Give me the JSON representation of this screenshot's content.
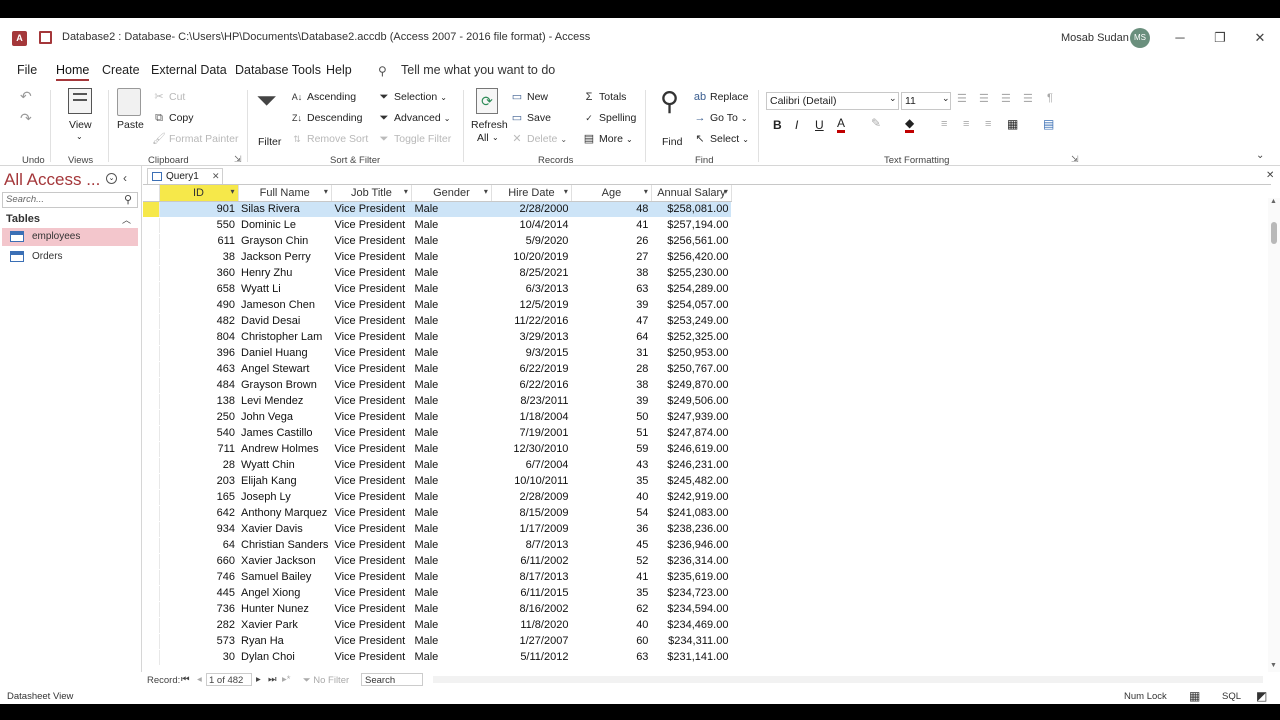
{
  "window": {
    "title": "Database2 : Database- C:\\Users\\HP\\Documents\\Database2.accdb (Access 2007 - 2016 file format)  -  Access",
    "user": "Mosab Sudan",
    "user_initials": "MS"
  },
  "menu": {
    "items": [
      "File",
      "Home",
      "Create",
      "External Data",
      "Database Tools",
      "Help"
    ],
    "tell_me": "Tell me what you want to do"
  },
  "ribbon": {
    "undo_label": "Undo",
    "views_label": "Views",
    "view_btn": "View",
    "clipboard": {
      "paste": "Paste",
      "cut": "Cut",
      "copy": "Copy",
      "format_painter": "Format Painter",
      "label": "Clipboard"
    },
    "sort": {
      "filter": "Filter",
      "ascending": "Ascending",
      "descending": "Descending",
      "remove_sort": "Remove Sort",
      "selection": "Selection",
      "advanced": "Advanced",
      "toggle_filter": "Toggle Filter",
      "label": "Sort & Filter"
    },
    "records": {
      "refresh": "Refresh",
      "all": "All",
      "new": "New",
      "save": "Save",
      "delete": "Delete",
      "totals": "Totals",
      "spelling": "Spelling",
      "more": "More",
      "label": "Records"
    },
    "find": {
      "find": "Find",
      "replace": "Replace",
      "goto": "Go To",
      "select": "Select",
      "label": "Find"
    },
    "text": {
      "font": "Calibri (Detail)",
      "size": "11",
      "label": "Text Formatting"
    }
  },
  "nav": {
    "title": "All Access ...",
    "search_placeholder": "Search...",
    "section": "Tables",
    "items": [
      "employees",
      "Orders"
    ]
  },
  "tab": {
    "name": "Query1"
  },
  "columns": [
    "ID",
    "Full Name",
    "Job Title",
    "Gender",
    "Hire Date",
    "Age",
    "Annual Salary"
  ],
  "rows": [
    [
      "901",
      "Silas Rivera",
      "Vice President",
      "Male",
      "2/28/2000",
      "48",
      "$258,081.00"
    ],
    [
      "550",
      "Dominic Le",
      "Vice President",
      "Male",
      "10/4/2014",
      "41",
      "$257,194.00"
    ],
    [
      "611",
      "Grayson Chin",
      "Vice President",
      "Male",
      "5/9/2020",
      "26",
      "$256,561.00"
    ],
    [
      "38",
      "Jackson Perry",
      "Vice President",
      "Male",
      "10/20/2019",
      "27",
      "$256,420.00"
    ],
    [
      "360",
      "Henry Zhu",
      "Vice President",
      "Male",
      "8/25/2021",
      "38",
      "$255,230.00"
    ],
    [
      "658",
      "Wyatt Li",
      "Vice President",
      "Male",
      "6/3/2013",
      "63",
      "$254,289.00"
    ],
    [
      "490",
      "Jameson Chen",
      "Vice President",
      "Male",
      "12/5/2019",
      "39",
      "$254,057.00"
    ],
    [
      "482",
      "David Desai",
      "Vice President",
      "Male",
      "11/22/2016",
      "47",
      "$253,249.00"
    ],
    [
      "804",
      "Christopher Lam",
      "Vice President",
      "Male",
      "3/29/2013",
      "64",
      "$252,325.00"
    ],
    [
      "396",
      "Daniel Huang",
      "Vice President",
      "Male",
      "9/3/2015",
      "31",
      "$250,953.00"
    ],
    [
      "463",
      "Angel Stewart",
      "Vice President",
      "Male",
      "6/22/2019",
      "28",
      "$250,767.00"
    ],
    [
      "484",
      "Grayson Brown",
      "Vice President",
      "Male",
      "6/22/2016",
      "38",
      "$249,870.00"
    ],
    [
      "138",
      "Levi Mendez",
      "Vice President",
      "Male",
      "8/23/2011",
      "39",
      "$249,506.00"
    ],
    [
      "250",
      "John Vega",
      "Vice President",
      "Male",
      "1/18/2004",
      "50",
      "$247,939.00"
    ],
    [
      "540",
      "James Castillo",
      "Vice President",
      "Male",
      "7/19/2001",
      "51",
      "$247,874.00"
    ],
    [
      "711",
      "Andrew Holmes",
      "Vice President",
      "Male",
      "12/30/2010",
      "59",
      "$246,619.00"
    ],
    [
      "28",
      "Wyatt Chin",
      "Vice President",
      "Male",
      "6/7/2004",
      "43",
      "$246,231.00"
    ],
    [
      "203",
      "Elijah Kang",
      "Vice President",
      "Male",
      "10/10/2011",
      "35",
      "$245,482.00"
    ],
    [
      "165",
      "Joseph Ly",
      "Vice President",
      "Male",
      "2/28/2009",
      "40",
      "$242,919.00"
    ],
    [
      "642",
      "Anthony Marquez",
      "Vice President",
      "Male",
      "8/15/2009",
      "54",
      "$241,083.00"
    ],
    [
      "934",
      "Xavier Davis",
      "Vice President",
      "Male",
      "1/17/2009",
      "36",
      "$238,236.00"
    ],
    [
      "64",
      "Christian Sanders",
      "Vice President",
      "Male",
      "8/7/2013",
      "45",
      "$236,946.00"
    ],
    [
      "660",
      "Xavier Jackson",
      "Vice President",
      "Male",
      "6/11/2002",
      "52",
      "$236,314.00"
    ],
    [
      "746",
      "Samuel Bailey",
      "Vice President",
      "Male",
      "8/17/2013",
      "41",
      "$235,619.00"
    ],
    [
      "445",
      "Angel Xiong",
      "Vice President",
      "Male",
      "6/11/2015",
      "35",
      "$234,723.00"
    ],
    [
      "736",
      "Hunter Nunez",
      "Vice President",
      "Male",
      "8/16/2002",
      "62",
      "$234,594.00"
    ],
    [
      "282",
      "Xavier Park",
      "Vice President",
      "Male",
      "11/8/2020",
      "40",
      "$234,469.00"
    ],
    [
      "573",
      "Ryan Ha",
      "Vice President",
      "Male",
      "1/27/2007",
      "60",
      "$234,311.00"
    ],
    [
      "30",
      "Dylan Choi",
      "Vice President",
      "Male",
      "5/11/2012",
      "63",
      "$231,141.00"
    ]
  ],
  "recnav": {
    "label": "Record:",
    "position": "1 of 482",
    "filter": "No Filter",
    "search": "Search"
  },
  "status": {
    "left": "Datasheet View",
    "numlock": "Num Lock",
    "sql": "SQL"
  }
}
